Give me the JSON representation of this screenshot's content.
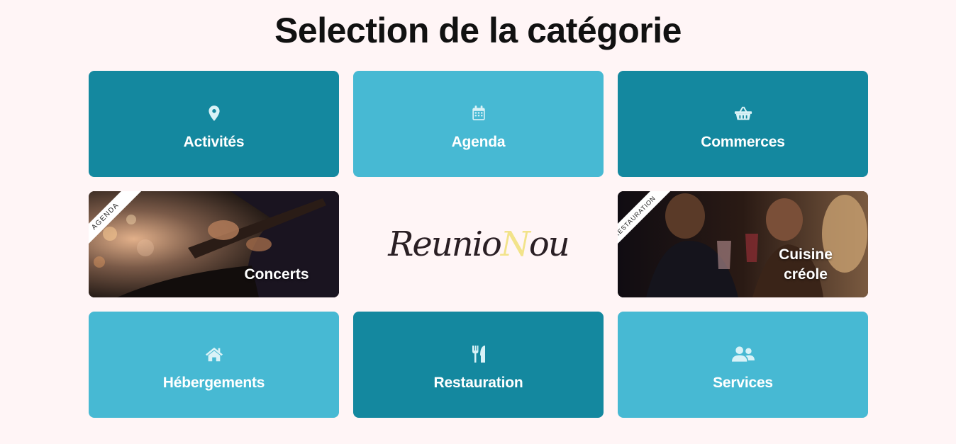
{
  "page": {
    "title": "Selection de la catégorie"
  },
  "tiles": {
    "activites": {
      "label": "Activités",
      "icon": "map-marker-icon"
    },
    "agenda": {
      "label": "Agenda",
      "icon": "calendar-icon"
    },
    "commerces": {
      "label": "Commerces",
      "icon": "basket-icon"
    },
    "hebergements": {
      "label": "Hébergements",
      "icon": "home-icon"
    },
    "restauration": {
      "label": "Restauration",
      "icon": "utensils-icon"
    },
    "services": {
      "label": "Services",
      "icon": "users-icon"
    }
  },
  "featured": {
    "concerts": {
      "ribbon": "AGENDA",
      "title": "Concerts"
    },
    "cuisine": {
      "ribbon": "RESTAURATION",
      "title_line1": "Cuisine",
      "title_line2": "créole"
    }
  },
  "logo": {
    "part1": "Reunio",
    "part2": "N",
    "part3": "ou"
  },
  "colors": {
    "dark": "#14889f",
    "light": "#47b9d3",
    "background": "#fff5f6",
    "icon": "#d9f2f7"
  }
}
